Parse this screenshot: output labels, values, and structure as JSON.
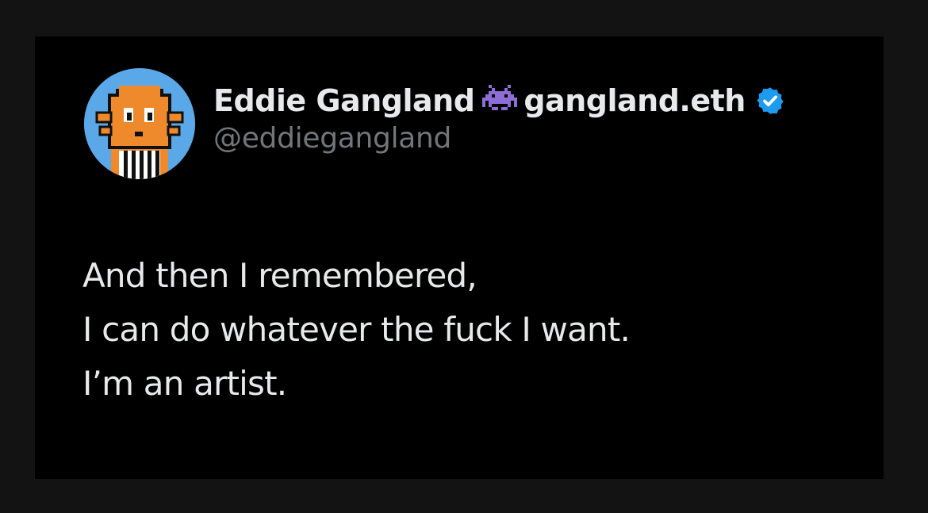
{
  "tweet": {
    "author": {
      "display_name": "Eddie Gangland",
      "name_suffix": "gangland.eth",
      "handle": "@eddiegangland",
      "emoji_icon": "alien-monster-icon",
      "verified": true,
      "verified_color": "#1d9bf0",
      "avatar": "pixel-art-orange-character-avatar",
      "avatar_bg_color": "#5aa8e8"
    },
    "lines": [
      "And then I remembered,",
      "I can do whatever the fuck I want.",
      "I’m an artist."
    ]
  },
  "colors": {
    "background": "#131313",
    "card": "#000000",
    "primary_text": "#e7e9ea",
    "secondary_text": "#71767b"
  }
}
